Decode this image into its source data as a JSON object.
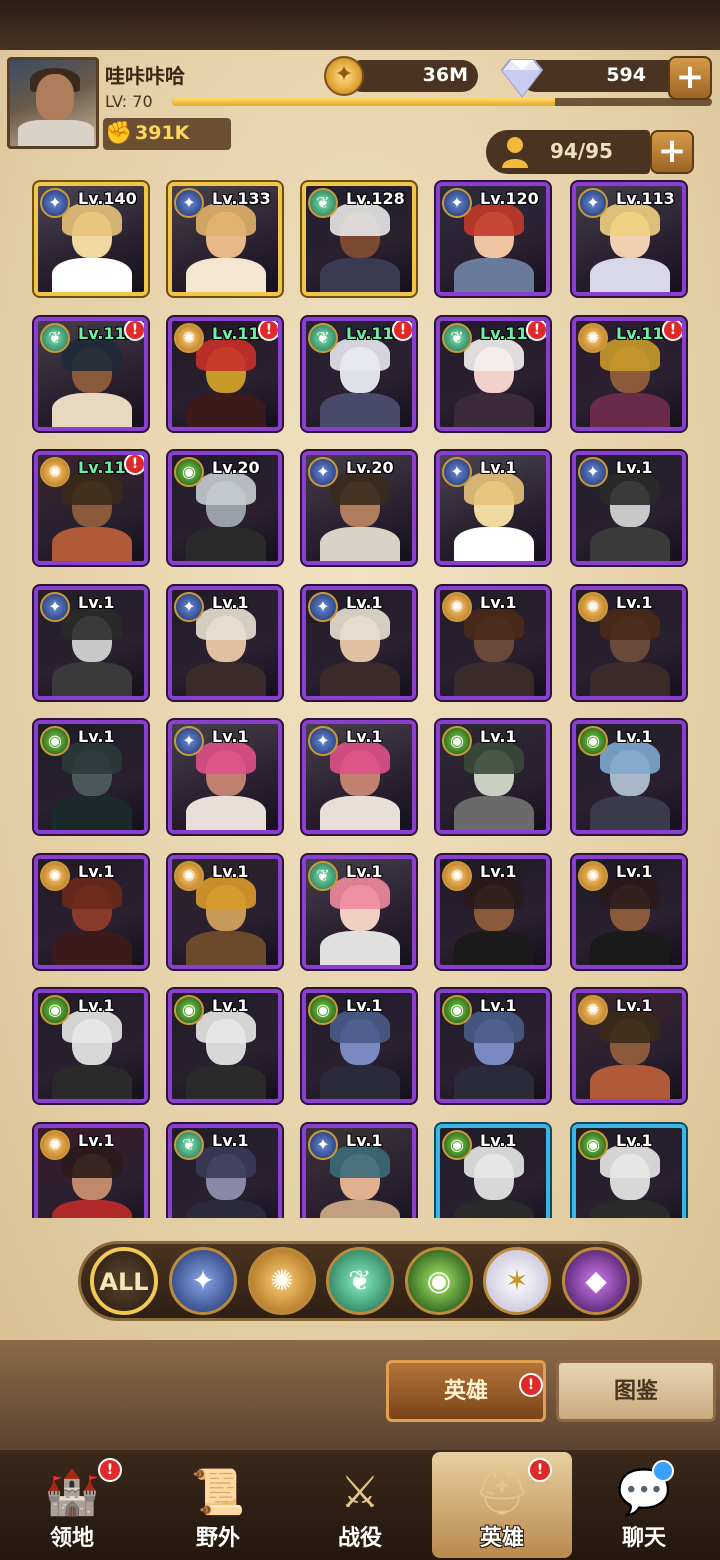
{
  "player": {
    "name": "哇咔咔哈",
    "level_text": "LV: 70",
    "xp_fraction": 0.71,
    "power": "391K"
  },
  "resources": {
    "gold": "36M",
    "diamonds": "594",
    "roster": "94/95"
  },
  "heroes": [
    {
      "level": "Lv.140",
      "faction": "lightbearer",
      "frame": "gold",
      "alert": false,
      "green": false,
      "palette": [
        "#f0d9a0",
        "#e8c27a",
        "#ffffff"
      ]
    },
    {
      "level": "Lv.133",
      "faction": "lightbearer",
      "frame": "gold",
      "alert": false,
      "green": false,
      "palette": [
        "#e8b88a",
        "#e0b26a",
        "#f4e6d0"
      ]
    },
    {
      "level": "Lv.128",
      "faction": "wilder",
      "frame": "gold",
      "alert": false,
      "green": false,
      "palette": [
        "#7a4a32",
        "#e8e8e8",
        "#3a3a52"
      ]
    },
    {
      "level": "Lv.120",
      "faction": "lightbearer",
      "frame": "purple",
      "alert": false,
      "green": false,
      "palette": [
        "#f0c4a0",
        "#c23a2a",
        "#6a7a9a"
      ]
    },
    {
      "level": "Lv.113",
      "faction": "lightbearer",
      "frame": "purple",
      "alert": false,
      "green": false,
      "palette": [
        "#f0d0b0",
        "#f0d080",
        "#d8d8e8"
      ]
    },
    {
      "level": "Lv.113",
      "faction": "wilder",
      "frame": "purple",
      "alert": true,
      "green": true,
      "palette": [
        "#8a5a3a",
        "#1e2a3a",
        "#e8d8c0"
      ]
    },
    {
      "level": "Lv.113",
      "faction": "mauler",
      "frame": "purple",
      "alert": true,
      "green": true,
      "palette": [
        "#c89a2a",
        "#c8302a",
        "#3a1a1a"
      ]
    },
    {
      "level": "Lv.113",
      "faction": "wilder",
      "frame": "purple",
      "alert": true,
      "green": true,
      "palette": [
        "#e0e0e8",
        "#e8e8f0",
        "#4a4a6a"
      ]
    },
    {
      "level": "Lv.113",
      "faction": "wilder",
      "frame": "purple",
      "alert": true,
      "green": true,
      "palette": [
        "#f0d0c8",
        "#f4f0f0",
        "#3a2a3a"
      ]
    },
    {
      "level": "Lv.113",
      "faction": "mauler",
      "frame": "purple",
      "alert": true,
      "green": true,
      "palette": [
        "#8a5a3a",
        "#c89a2a",
        "#6a2a4a"
      ]
    },
    {
      "level": "Lv.113",
      "faction": "mauler",
      "frame": "purple",
      "alert": true,
      "green": true,
      "palette": [
        "#8a5a3a",
        "#3a2a1a",
        "#b05a3a"
      ]
    },
    {
      "level": "Lv.20",
      "faction": "grave",
      "frame": "purple",
      "alert": false,
      "green": false,
      "palette": [
        "#9aa0a8",
        "#c8ccd0",
        "#2a2a2a"
      ]
    },
    {
      "level": "Lv.20",
      "faction": "lightbearer",
      "frame": "purple",
      "alert": false,
      "green": false,
      "palette": [
        "#b07d5c",
        "#3a2a1d",
        "#d8d3c6"
      ]
    },
    {
      "level": "Lv.1",
      "faction": "lightbearer",
      "frame": "purple",
      "alert": false,
      "green": false,
      "palette": [
        "#f0d9a0",
        "#e8c27a",
        "#ffffff"
      ]
    },
    {
      "level": "Lv.1",
      "faction": "lightbearer",
      "frame": "purple",
      "alert": false,
      "green": false,
      "palette": [
        "#c8c8c8",
        "#2a2a2a",
        "#3a3a3a"
      ]
    },
    {
      "level": "Lv.1",
      "faction": "lightbearer",
      "frame": "purple",
      "alert": false,
      "green": false,
      "palette": [
        "#c8c8c8",
        "#2a2a2a",
        "#3a3a3a"
      ]
    },
    {
      "level": "Lv.1",
      "faction": "lightbearer",
      "frame": "purple",
      "alert": false,
      "green": false,
      "palette": [
        "#e0c0a0",
        "#e8e0d0",
        "#3a2a2a"
      ]
    },
    {
      "level": "Lv.1",
      "faction": "lightbearer",
      "frame": "purple",
      "alert": false,
      "green": false,
      "palette": [
        "#e0c0a0",
        "#e8e0d0",
        "#3a2a2a"
      ]
    },
    {
      "level": "Lv.1",
      "faction": "mauler",
      "frame": "purple",
      "alert": false,
      "green": false,
      "palette": [
        "#6a4a3a",
        "#4a2a1a",
        "#3a2a2a"
      ]
    },
    {
      "level": "Lv.1",
      "faction": "mauler",
      "frame": "purple",
      "alert": false,
      "green": false,
      "palette": [
        "#6a4a3a",
        "#4a2a1a",
        "#3a2a2a"
      ]
    },
    {
      "level": "Lv.1",
      "faction": "grave",
      "frame": "purple",
      "alert": false,
      "green": false,
      "palette": [
        "#4a5a5a",
        "#2a3a3a",
        "#1a2a2a"
      ]
    },
    {
      "level": "Lv.1",
      "faction": "lightbearer",
      "frame": "purple",
      "alert": false,
      "green": false,
      "palette": [
        "#c08070",
        "#e0508a",
        "#e8e0d8"
      ]
    },
    {
      "level": "Lv.1",
      "faction": "lightbearer",
      "frame": "purple",
      "alert": false,
      "green": false,
      "palette": [
        "#c08070",
        "#e0508a",
        "#e8e0d8"
      ]
    },
    {
      "level": "Lv.1",
      "faction": "grave",
      "frame": "purple",
      "alert": false,
      "green": false,
      "palette": [
        "#c8d0c0",
        "#3a4a3a",
        "#6a6a6a"
      ]
    },
    {
      "level": "Lv.1",
      "faction": "grave",
      "frame": "purple",
      "alert": false,
      "green": false,
      "palette": [
        "#a8b8c8",
        "#80a8d0",
        "#3a3a4a"
      ]
    },
    {
      "level": "Lv.1",
      "faction": "mauler",
      "frame": "purple",
      "alert": false,
      "green": false,
      "palette": [
        "#8a3a2a",
        "#6a2a1a",
        "#3a1a1a"
      ]
    },
    {
      "level": "Lv.1",
      "faction": "mauler",
      "frame": "purple",
      "alert": false,
      "green": false,
      "palette": [
        "#c89a5a",
        "#d89a2a",
        "#6a4a2a"
      ]
    },
    {
      "level": "Lv.1",
      "faction": "wilder",
      "frame": "purple",
      "alert": false,
      "green": false,
      "palette": [
        "#f0d0c0",
        "#f08aa0",
        "#e0e0e0"
      ]
    },
    {
      "level": "Lv.1",
      "faction": "mauler",
      "frame": "purple",
      "alert": false,
      "green": false,
      "palette": [
        "#8a5a3a",
        "#2a1a1a",
        "#1a1a1a"
      ]
    },
    {
      "level": "Lv.1",
      "faction": "mauler",
      "frame": "purple",
      "alert": false,
      "green": false,
      "palette": [
        "#8a5a3a",
        "#2a1a1a",
        "#1a1a1a"
      ]
    },
    {
      "level": "Lv.1",
      "faction": "grave",
      "frame": "purple",
      "alert": false,
      "green": false,
      "palette": [
        "#d8d8d8",
        "#e8e8e8",
        "#2a2a2a"
      ]
    },
    {
      "level": "Lv.1",
      "faction": "grave",
      "frame": "purple",
      "alert": false,
      "green": false,
      "palette": [
        "#d8d8d8",
        "#e8e8e8",
        "#2a2a2a"
      ]
    },
    {
      "level": "Lv.1",
      "faction": "grave",
      "frame": "purple",
      "alert": false,
      "green": false,
      "palette": [
        "#7a8ac0",
        "#4a5a8a",
        "#2a2a3a"
      ]
    },
    {
      "level": "Lv.1",
      "faction": "grave",
      "frame": "purple",
      "alert": false,
      "green": false,
      "palette": [
        "#7a8ac0",
        "#4a5a8a",
        "#2a2a3a"
      ]
    },
    {
      "level": "Lv.1",
      "faction": "mauler",
      "frame": "purple",
      "alert": false,
      "green": false,
      "palette": [
        "#8a5a3a",
        "#3a2a1a",
        "#b05a3a"
      ]
    },
    {
      "level": "Lv.1",
      "faction": "mauler",
      "frame": "purple",
      "alert": false,
      "green": false,
      "palette": [
        "#c08a6a",
        "#2a1a1a",
        "#b02a2a"
      ]
    },
    {
      "level": "Lv.1",
      "faction": "wilder",
      "frame": "purple",
      "alert": false,
      "green": false,
      "palette": [
        "#8a8aa8",
        "#3a3a5a",
        "#2a2a3a"
      ]
    },
    {
      "level": "Lv.1",
      "faction": "lightbearer",
      "frame": "purple",
      "alert": false,
      "green": false,
      "palette": [
        "#e0b090",
        "#3a6a7a",
        "#c0a080"
      ]
    },
    {
      "level": "Lv.1",
      "faction": "grave",
      "frame": "blue",
      "alert": false,
      "green": false,
      "palette": [
        "#d8d8d8",
        "#e8e8e8",
        "#2a2a2a"
      ]
    },
    {
      "level": "Lv.1",
      "faction": "grave",
      "frame": "blue",
      "alert": false,
      "green": false,
      "palette": [
        "#d8d8d8",
        "#e8e8e8",
        "#2a2a2a"
      ]
    }
  ],
  "filters": [
    {
      "id": "all",
      "label": "ALL",
      "icon": "all-factions-icon",
      "active": true
    },
    {
      "id": "lightbearer",
      "label": "",
      "icon": "lightbearer-faction-icon",
      "color": "#3a5aa8"
    },
    {
      "id": "mauler",
      "label": "",
      "icon": "mauler-faction-icon",
      "color": "#d89020"
    },
    {
      "id": "wilder",
      "label": "",
      "icon": "wilder-faction-icon",
      "color": "#2aa878"
    },
    {
      "id": "graveborn",
      "label": "",
      "icon": "graveborn-faction-icon",
      "color": "#3a8a2a"
    },
    {
      "id": "celestial",
      "label": "",
      "icon": "celestial-faction-icon",
      "color": "#e8e4f0"
    },
    {
      "id": "hypogean",
      "label": "",
      "icon": "hypogean-faction-icon",
      "color": "#7a3ab0"
    }
  ],
  "subtabs": {
    "heroes": "英雄",
    "codex": "图鉴"
  },
  "nav": [
    {
      "label": "领地",
      "icon": "castle-icon",
      "alert": true,
      "active": false
    },
    {
      "label": "野外",
      "icon": "map-scroll-icon",
      "alert": false,
      "active": false
    },
    {
      "label": "战役",
      "icon": "campaign-sword-icon",
      "alert": false,
      "active": false
    },
    {
      "label": "英雄",
      "icon": "hero-helmet-icon",
      "alert": true,
      "active": true
    },
    {
      "label": "聊天",
      "icon": "chat-bubble-icon",
      "alert": false,
      "active": false,
      "blue_dot": true
    }
  ],
  "alert_mark": "!",
  "colors": {
    "gold_frame": "#f0c64a",
    "purple_frame": "#8a3fd0",
    "blue_frame": "#39b6e6",
    "alert": "#e02a2a"
  }
}
